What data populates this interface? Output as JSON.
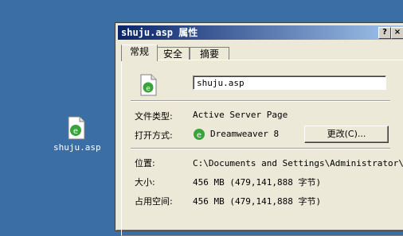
{
  "desktop": {
    "file_label": "shuju.asp",
    "icon": "dreamweaver-file-icon"
  },
  "dialog": {
    "title": "shuju.asp 属性",
    "help_button": "?",
    "close_button": "×",
    "tabs": [
      {
        "label": "常规",
        "active": true
      },
      {
        "label": "安全",
        "active": false
      },
      {
        "label": "摘要",
        "active": false
      }
    ],
    "general": {
      "file_name": "shuju.asp",
      "file_type_label": "文件类型:",
      "file_type_value": "Active Server Page",
      "open_with_label": "打开方式:",
      "open_with_value": "Dreamweaver 8",
      "change_button": "更改(C)...",
      "location_label": "位置:",
      "location_value": "C:\\Documents and Settings\\Administrator\\桌",
      "size_label": "大小:",
      "size_value": "456 MB (479,141,888 字节)",
      "size_on_disk_label": "占用空间:",
      "size_on_disk_value": "456 MB (479,141,888 字节)"
    }
  },
  "colors": {
    "desktop": "#3a6ea5",
    "titlebar_start": "#0a246a",
    "titlebar_end": "#a6caf0",
    "dw_green": "#3aa33a"
  }
}
